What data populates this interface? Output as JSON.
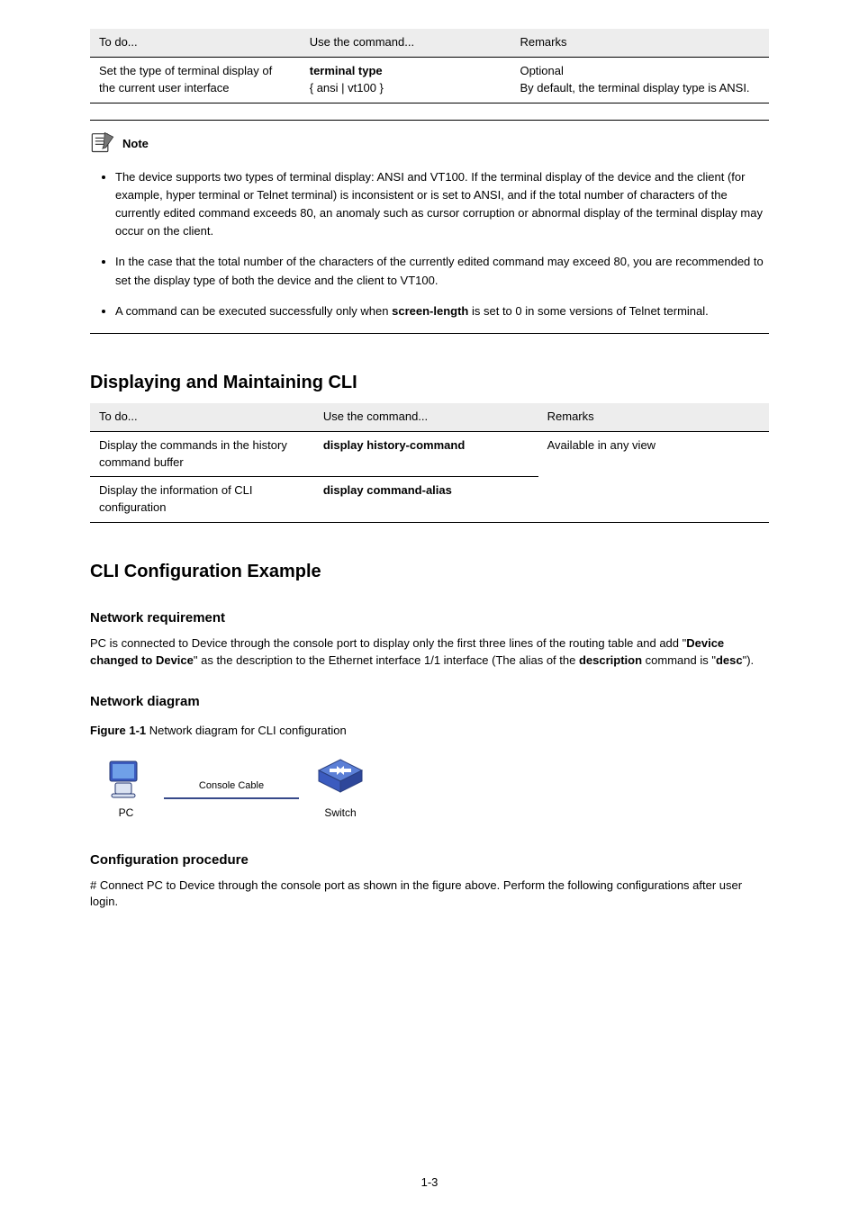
{
  "page_number": "1-3",
  "table1": {
    "head": {
      "c1": "To do...",
      "c2": "Use the command...",
      "c3": "Remarks"
    },
    "row": {
      "c1": "Set the type of terminal display of the current user interface",
      "c2_l1": "terminal type",
      "c2_l2": "{ ansi | vt100 }",
      "c3_l1": "Optional",
      "c3_l2": "By default, the terminal display type is ANSI."
    }
  },
  "note": {
    "label": "Note",
    "b1": "The device supports two types of terminal display: ANSI and VT100. If the terminal display of the device and the client (for example, hyper terminal or Telnet terminal) is inconsistent or is set to ANSI, and if the total number of characters of the currently edited command exceeds 80, an anomaly such as cursor corruption or abnormal display of the terminal display may occur on the client.",
    "b2": "In the case that the total number of the characters of the currently edited command may exceed 80, you are recommended to set the display type of both the device and the client to VT100.",
    "b3_p1": "A command can be executed successfully only when ",
    "b3_b": "screen-length",
    "b3_p2": " is set to 0 in some versions of Telnet terminal."
  },
  "display_heading": "Displaying and Maintaining CLI",
  "table2": {
    "head": {
      "c1": "To do...",
      "c2": "Use the command...",
      "c3": "Remarks"
    },
    "r1": {
      "c1": "Display the commands in the history command buffer",
      "c2_l1": "display history-command",
      "c2_l2": ""
    },
    "r2": {
      "c1": "Display the information of CLI configuration",
      "c2_l1": "display command-alias",
      "c2_l2": ""
    },
    "remark": "Available in any view"
  },
  "cli_heading": "CLI Configuration Example",
  "net_req_heading": "Network requirement",
  "net_req_body_p1": "PC is connected to Device through the console port to display only the first three lines of the routing table and add \"",
  "net_req_body_b1": "Device changed to Device",
  "net_req_body_p2": "\" as the description to the Ethernet interface 1/1 interface (The alias of the ",
  "net_req_body_b2": "description ",
  "net_req_body_p3": "command is \"",
  "net_req_body_b3": "desc",
  "net_req_body_p4": "\").",
  "net_diag_heading": "Network diagram",
  "fig_caption_label": "Figure 1-1",
  "fig_caption_text": " Network diagram for CLI configuration",
  "diagram": {
    "cable": "Console Cable",
    "pc": "PC",
    "switch": "Switch"
  },
  "cfg_proc_heading": "Configuration procedure",
  "cfg_proc_body": "# Connect PC to Device through the console port as shown in the figure above. Perform the following configurations after user login."
}
